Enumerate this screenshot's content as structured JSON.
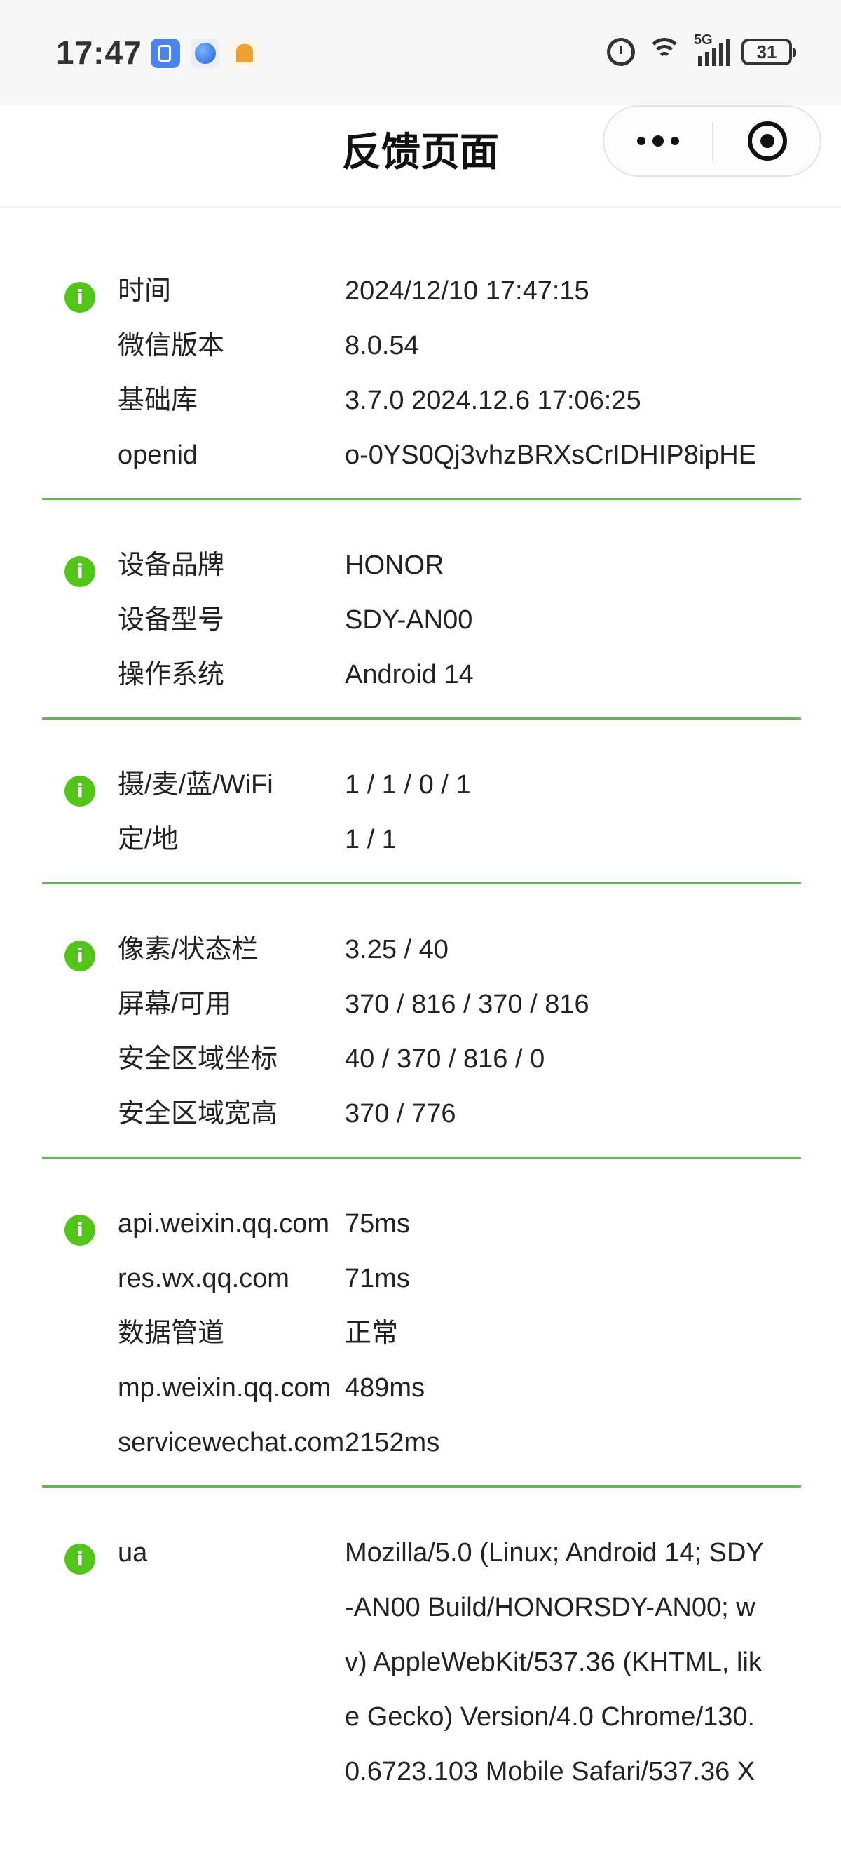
{
  "status_bar": {
    "time": "17:47",
    "signal_label": "5G",
    "battery": "31",
    "icons": [
      "app-lock-icon",
      "browser-icon",
      "mascot-icon",
      "alarm-icon",
      "wifi-icon",
      "signal-icon",
      "battery-icon"
    ]
  },
  "navbar": {
    "title": "反馈页面",
    "more_icon": "more-dots-icon",
    "close_icon": "target-icon"
  },
  "colors": {
    "accent_green": "#52c41a",
    "divider_green": "#5fb84c"
  },
  "sections": [
    {
      "rows": [
        {
          "label": "时间",
          "value": "2024/12/10 17:47:15"
        },
        {
          "label": "微信版本",
          "value": "8.0.54"
        },
        {
          "label": "基础库",
          "value": "3.7.0 2024.12.6 17:06:25"
        },
        {
          "label": "openid",
          "value": "o-0YS0Qj3vhzBRXsCrIDHIP8ipHE"
        }
      ]
    },
    {
      "rows": [
        {
          "label": "设备品牌",
          "value": "HONOR"
        },
        {
          "label": "设备型号",
          "value": "SDY-AN00"
        },
        {
          "label": "操作系统",
          "value": "Android 14"
        }
      ]
    },
    {
      "rows": [
        {
          "label": "摄/麦/蓝/WiFi",
          "value": "1 / 1 / 0 / 1"
        },
        {
          "label": "定/地",
          "value": "1 / 1"
        }
      ]
    },
    {
      "rows": [
        {
          "label": "像素/状态栏",
          "value": "3.25 / 40"
        },
        {
          "label": "屏幕/可用",
          "value": "370 / 816 / 370 / 816"
        },
        {
          "label": "安全区域坐标",
          "value": "40 / 370 / 816 / 0"
        },
        {
          "label": "安全区域宽高",
          "value": "370 / 776"
        }
      ]
    },
    {
      "rows": [
        {
          "label": "api.weixin.qq.com",
          "value": "75ms"
        },
        {
          "label": "res.wx.qq.com",
          "value": "71ms"
        },
        {
          "label": "数据管道",
          "value": "正常"
        },
        {
          "label": "mp.weixin.qq.com",
          "value": "489ms"
        },
        {
          "label": "servicewechat.com",
          "value": "2152ms"
        }
      ]
    },
    {
      "rows": [
        {
          "label": "ua",
          "value": "Mozilla/5.0 (Linux; Android 14; SDY-AN00 Build/HONORSDY-AN00; wv) AppleWebKit/537.36 (KHTML, like Gecko) Version/4.0 Chrome/130.0.6723.103 Mobile Safari/537.36 X"
        }
      ]
    }
  ]
}
